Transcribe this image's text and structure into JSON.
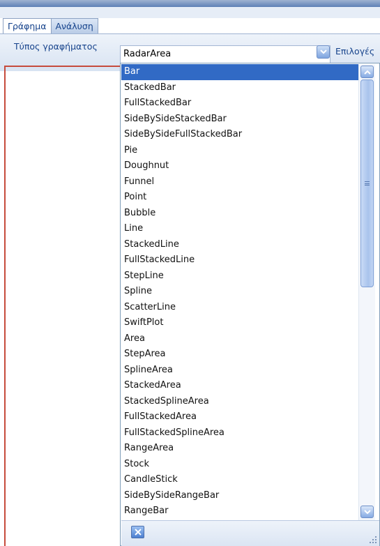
{
  "tabs": [
    {
      "label": "Γράφημα"
    },
    {
      "label": "Ανάλυση"
    }
  ],
  "toolbar": {
    "chart_type_label": "Τύπος γραφήματος",
    "chart_type_value": "RadarArea",
    "options_label": "Επιλογές"
  },
  "dropdown": {
    "selected": "Bar",
    "items": [
      "Bar",
      "StackedBar",
      "FullStackedBar",
      "SideBySideStackedBar",
      "SideBySideFullStackedBar",
      "Pie",
      "Doughnut",
      "Funnel",
      "Point",
      "Bubble",
      "Line",
      "StackedLine",
      "FullStackedLine",
      "StepLine",
      "Spline",
      "ScatterLine",
      "SwiftPlot",
      "Area",
      "StepArea",
      "SplineArea",
      "StackedArea",
      "StackedSplineArea",
      "FullStackedArea",
      "FullStackedSplineArea",
      "RangeArea",
      "Stock",
      "CandleStick",
      "SideBySideRangeBar",
      "RangeBar"
    ]
  },
  "icons": {
    "dropdown_arrow": "chevron-down-icon",
    "scroll_up": "chevron-up-icon",
    "scroll_down": "chevron-down-icon",
    "close": "close-icon",
    "resize": "resize-grip-icon"
  },
  "colors": {
    "selection": "#316ac5",
    "accent_text": "#15428b",
    "border_red": "#c64b3c"
  }
}
